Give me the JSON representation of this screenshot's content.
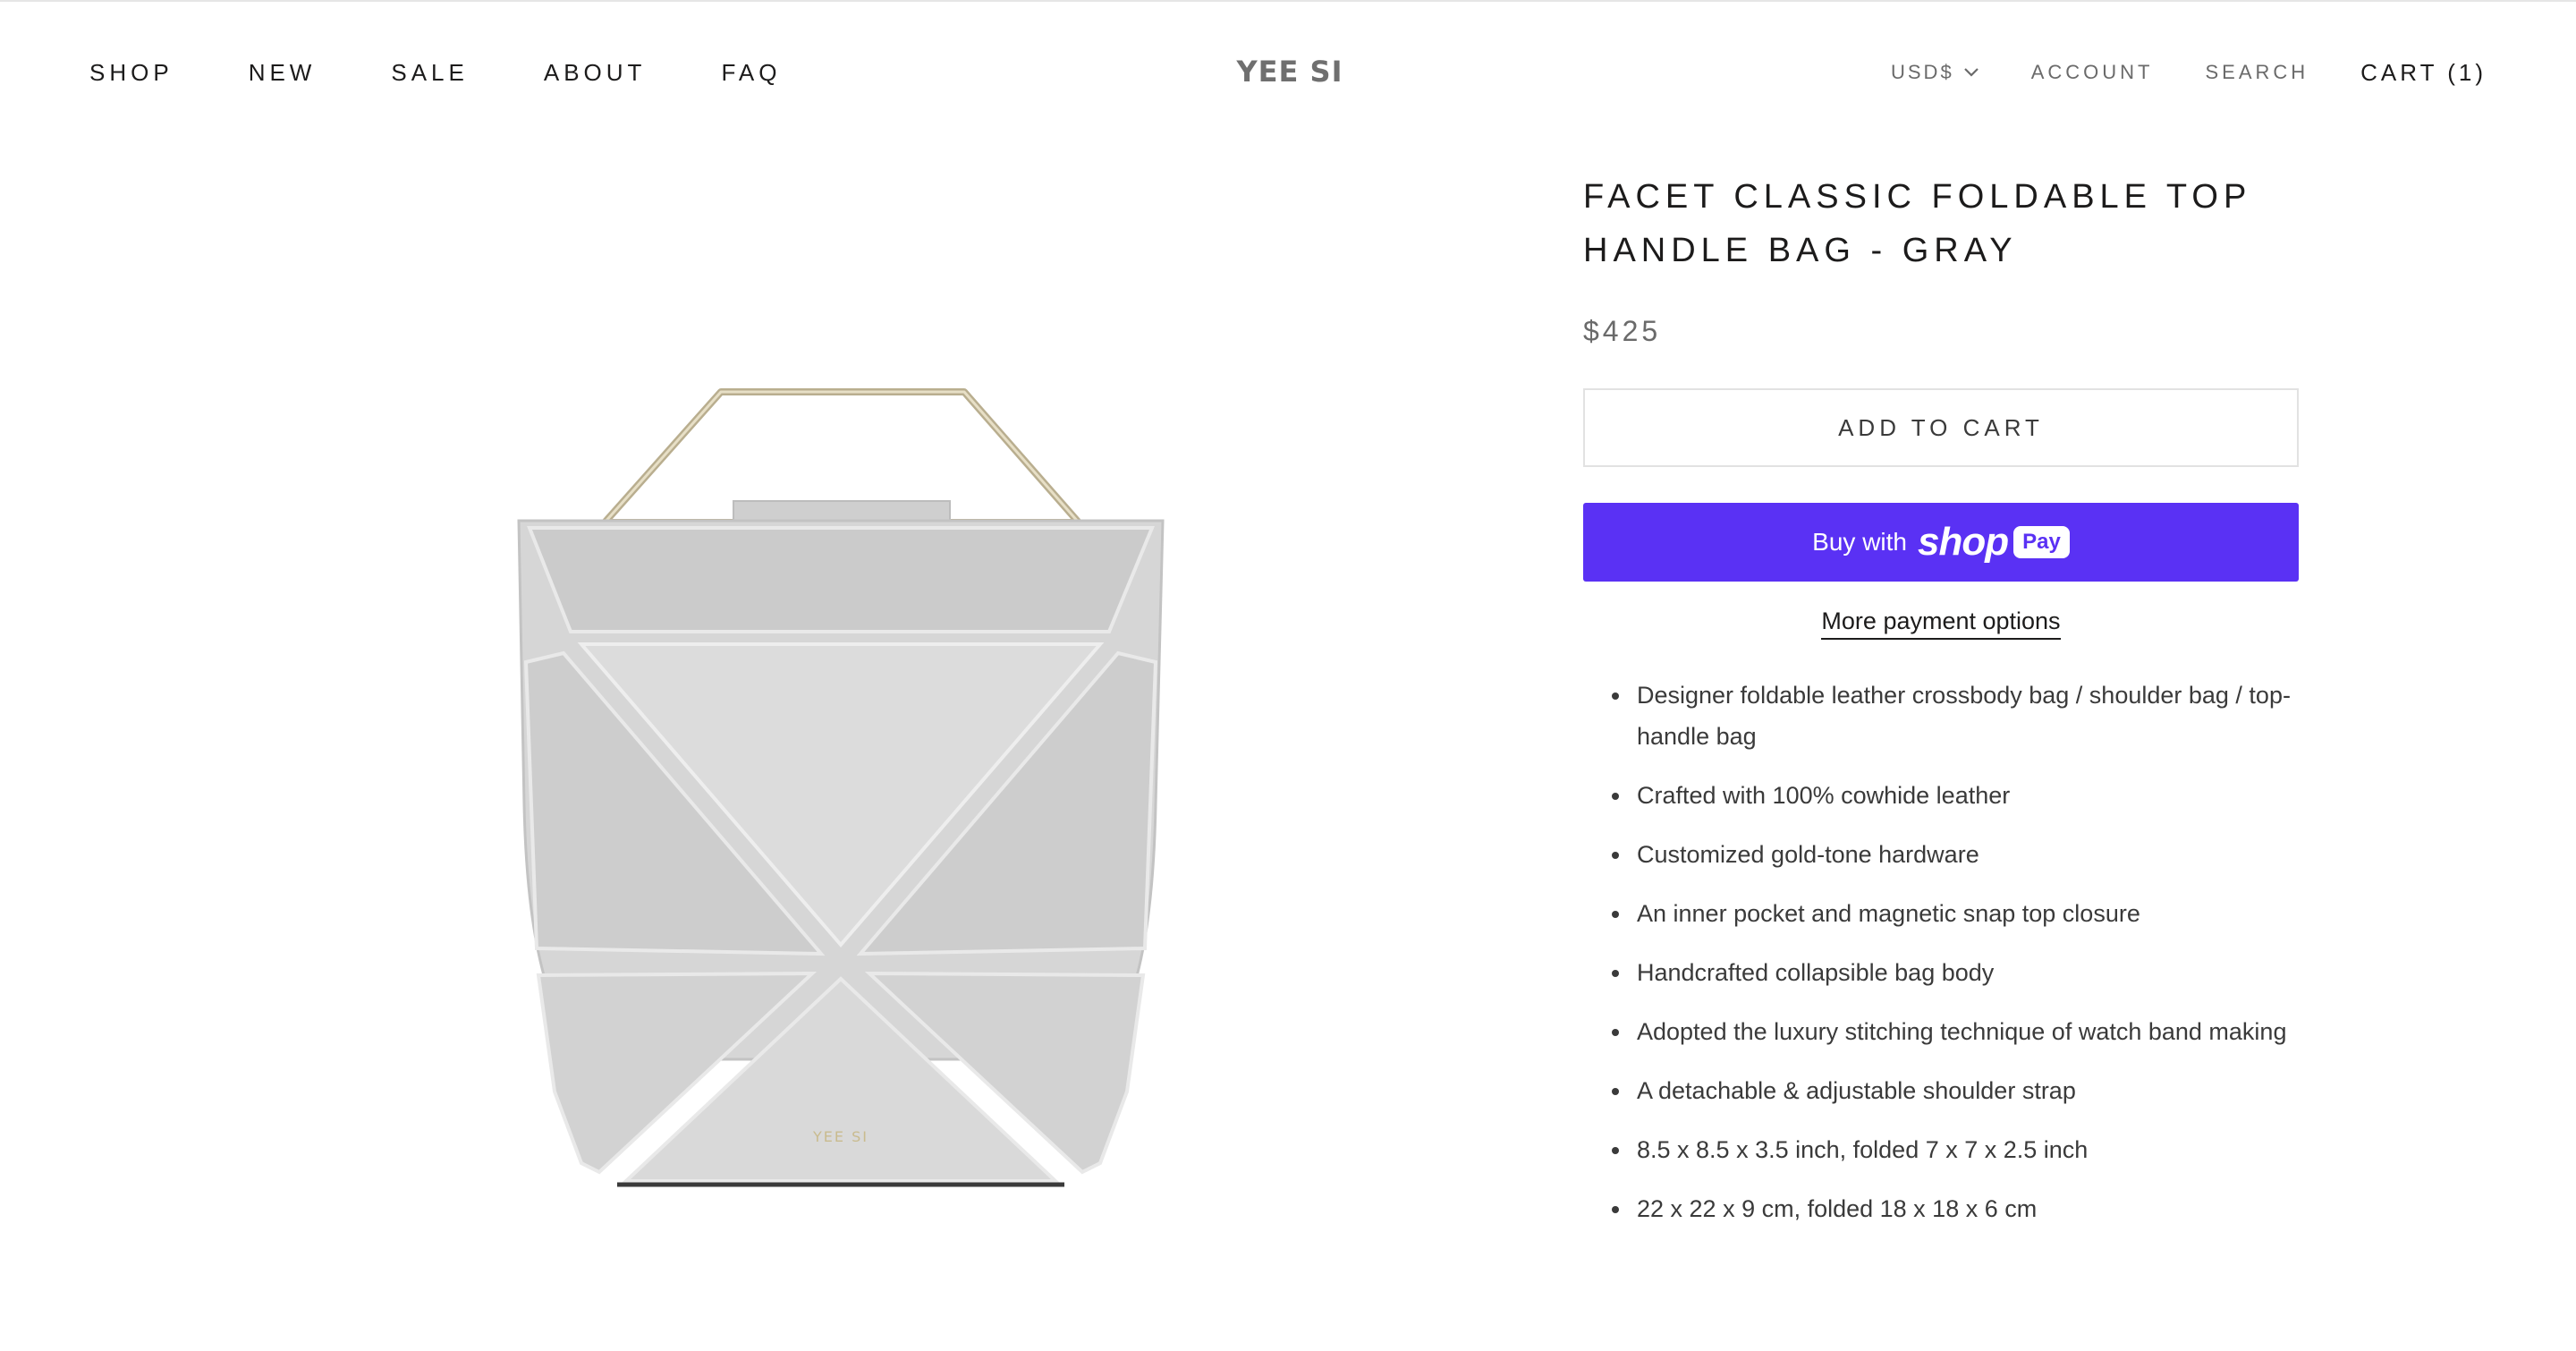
{
  "header": {
    "nav": [
      "SHOP",
      "NEW",
      "SALE",
      "ABOUT",
      "FAQ"
    ],
    "logo": "YEE SI",
    "currency": "USD$",
    "account": "ACCOUNT",
    "search": "SEARCH",
    "cart": "CART (1)"
  },
  "product": {
    "title": "FACET CLASSIC FOLDABLE TOP HANDLE BAG - GRAY",
    "price": "$425",
    "add_to_cart": "ADD TO CART",
    "buy_with": "Buy with",
    "shop_word": "shop",
    "pay_word": "Pay",
    "more_payment": "More payment options",
    "bag_stamp": "YEE SI",
    "features": [
      "Designer foldable leather crossbody bag / shoulder bag / top-handle bag",
      "Crafted with 100% cowhide leather",
      "Customized gold-tone hardware",
      "An inner pocket and magnetic snap top closure",
      "Handcrafted collapsible bag body",
      "Adopted the luxury stitching technique of watch band making",
      "A detachable & adjustable shoulder strap",
      "8.5 x 8.5 x 3.5 inch, folded 7 x 7 x 2.5 inch",
      "22 x 22 x 9 cm, folded 18 x 18 x 6 cm"
    ]
  },
  "colors": {
    "shop_pay": "#5a31f4",
    "text": "#1c1b1b",
    "muted": "#6a6a6a",
    "bag": "#d6d6d6",
    "hardware": "#b9ae8f"
  }
}
